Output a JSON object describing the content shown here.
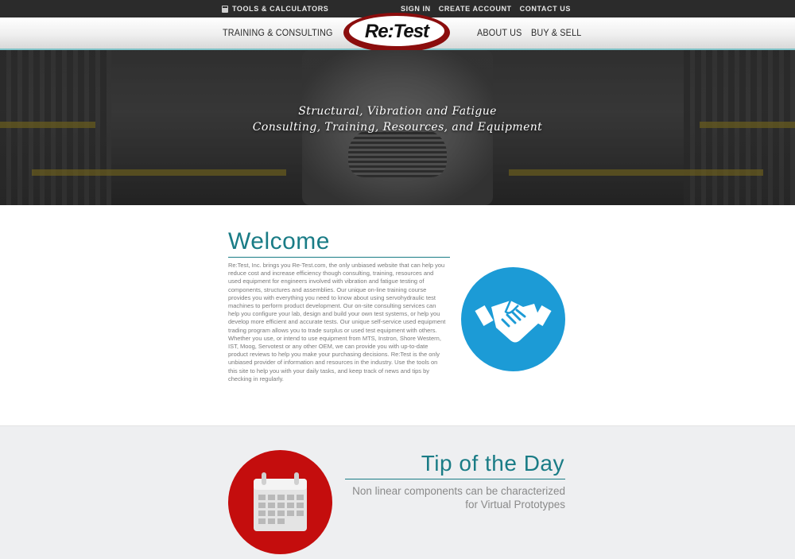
{
  "topbar": {
    "tools_label": "TOOLS & CALCULATORS",
    "links": [
      "SIGN IN",
      "CREATE ACCOUNT",
      "CONTACT US"
    ]
  },
  "nav": {
    "items": [
      "TRAINING & CONSULTING",
      "ABOUT US",
      "BUY & SELL"
    ],
    "logo_text": "Re:Test"
  },
  "hero": {
    "tagline_line1": "Structural, Vibration and Fatigue",
    "tagline_line2": "Consulting, Training, Resources, and Equipment"
  },
  "welcome": {
    "title": "Welcome",
    "body": "Re:Test, Inc. brings you Re-Test.com, the only unbiased website that can help you reduce cost and increase efficiency though consulting, training, resources and used equipment for engineers involved with vibration and fatigue testing of components, structures and assemblies. Our unique on-line training course provides you with everything you need to know about using servohydraulic test machines to perform product development. Our on-site consulting services can help you configure your lab, design and build your own test systems, or help you develop more efficient and accurate tests. Our unique self-service used equipment trading program allows you to trade surplus or used test equipment with others. Whether you use, or intend to use equipment from MTS, Instron, Shore Western, IST, Moog, Servotest or any other OEM, we can provide you with up-to-date product reviews to help you make your purchasing decisions. Re:Test is the only unbiased provider of information and resources in the industry. Use the tools on this site to help you with your daily tasks, and keep track of news and tips by checking in regularly."
  },
  "tip": {
    "title": "Tip of the Day",
    "text": "Non linear components can be characterized for Virtual Prototypes"
  },
  "colors": {
    "accent_teal": "#1a7c86",
    "handshake_blue": "#1c9bd6",
    "calendar_red": "#c40d0d",
    "logo_red": "#8b0d0d",
    "topbar": "#2b2b2b"
  },
  "icons": [
    "calculator-icon",
    "handshake-icon",
    "calendar-icon"
  ]
}
